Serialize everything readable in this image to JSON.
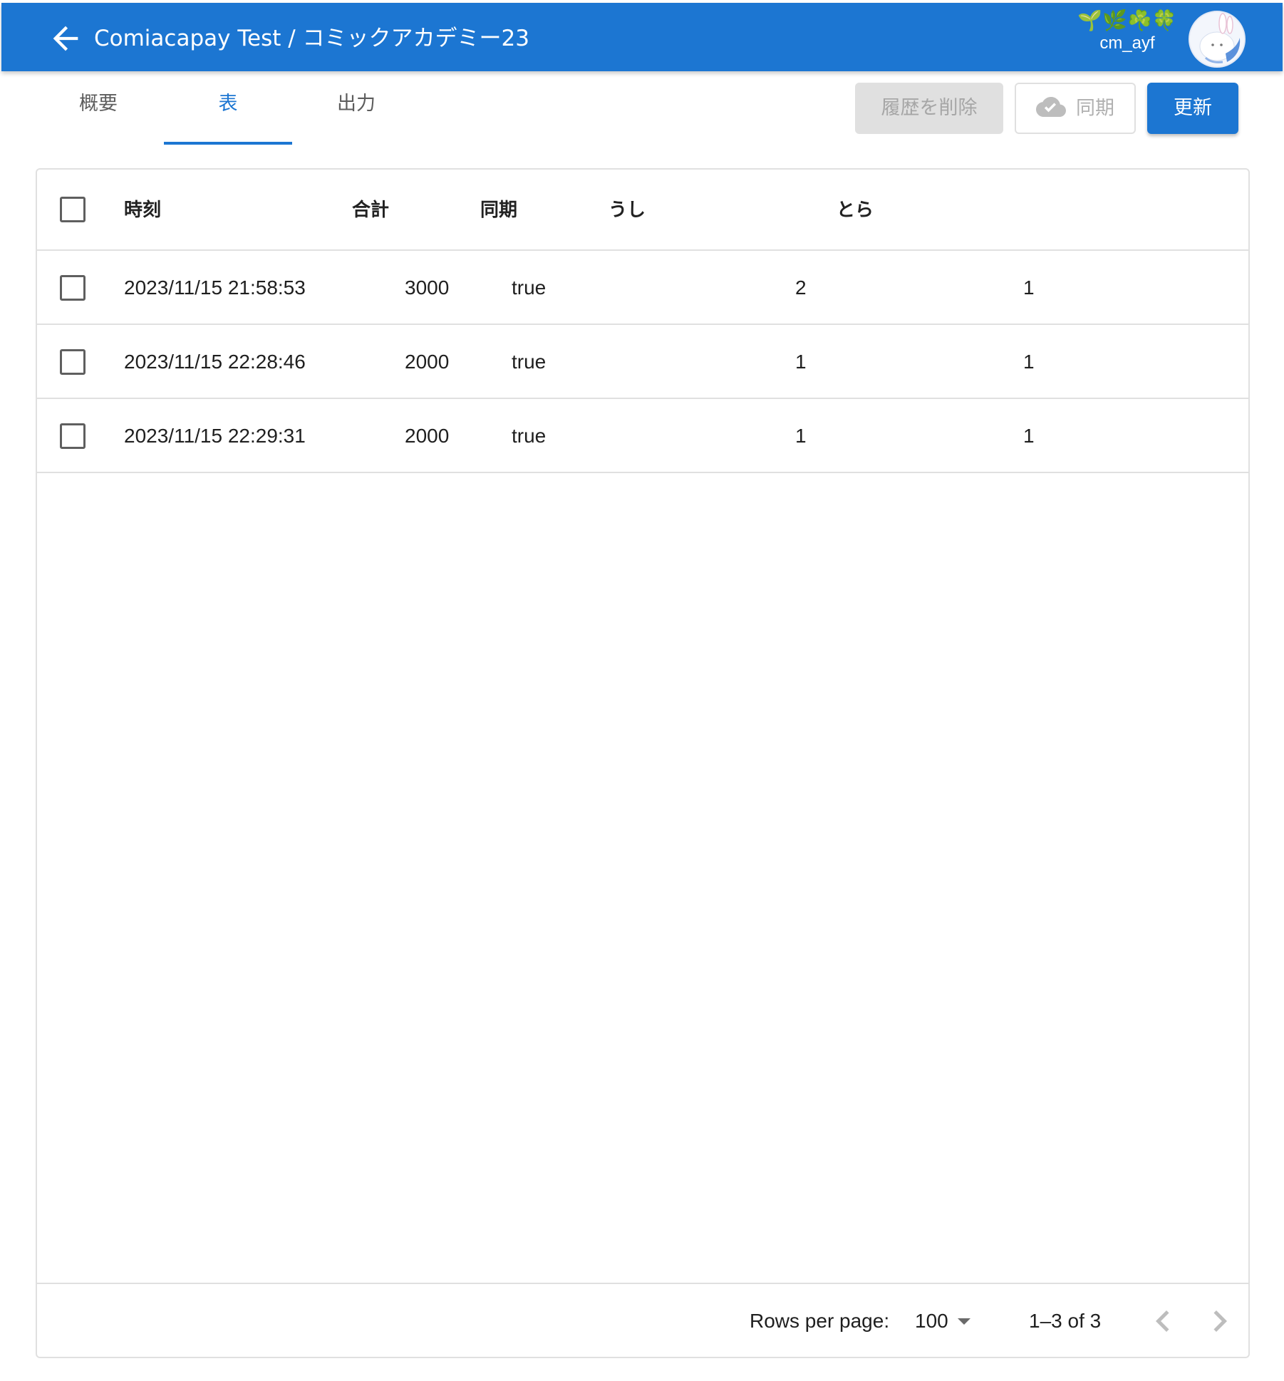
{
  "header": {
    "title": "Comiacapay Test / コミックアカデミー23",
    "user_emoji": "🌱🌿☘️🍀",
    "user_name": "cm_ayf"
  },
  "tabs": [
    {
      "label": "概要",
      "active": false
    },
    {
      "label": "表",
      "active": true
    },
    {
      "label": "出力",
      "active": false
    }
  ],
  "toolbar": {
    "clear_history_label": "履歴を削除",
    "sync_label": "同期",
    "refresh_label": "更新"
  },
  "table": {
    "columns": [
      "時刻",
      "合計",
      "同期",
      "うし",
      "とら"
    ],
    "rows": [
      {
        "time": "2023/11/15 21:58:53",
        "total": "3000",
        "synced": "true",
        "ushi": "2",
        "tora": "1"
      },
      {
        "time": "2023/11/15 22:28:46",
        "total": "2000",
        "synced": "true",
        "ushi": "1",
        "tora": "1"
      },
      {
        "time": "2023/11/15 22:29:31",
        "total": "2000",
        "synced": "true",
        "ushi": "1",
        "tora": "1"
      }
    ]
  },
  "pagination": {
    "rows_per_page_label": "Rows per page:",
    "rows_per_page_value": "100",
    "range_text": "1–3 of 3"
  },
  "colors": {
    "primary": "#1c76d2",
    "disabled_bg": "#e0e0e0",
    "border": "#e0e0e0"
  }
}
